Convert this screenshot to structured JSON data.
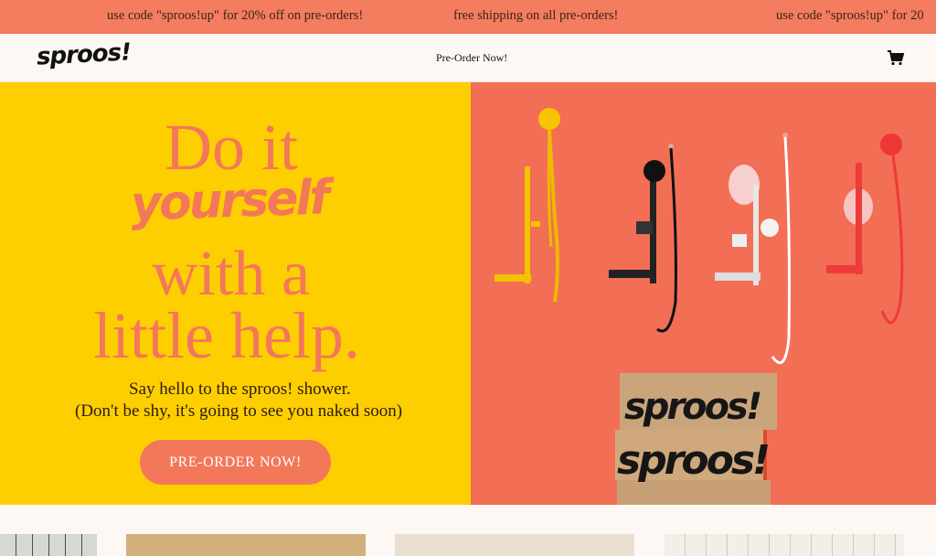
{
  "announcement": {
    "messages": [
      "use code \"sproos!up\" for 20% off on pre-orders!",
      "free shipping on all pre-orders!",
      "use code \"sproos!up\" for 20"
    ]
  },
  "header": {
    "logo": "sproos!",
    "nav_link": "Pre-Order Now!",
    "cart_icon": "cart-icon"
  },
  "hero": {
    "line1": "Do it",
    "line2": "yourself",
    "line3": "with a",
    "line4": "little help.",
    "sub1": "Say hello to the sproos! shower.",
    "sub2": "(Don't be shy, it's going to see you naked soon)",
    "cta": "PRE-ORDER NOW!",
    "box_label": "sproos!",
    "colors": {
      "left_bg": "#fecf00",
      "right_bg": "#f26e55",
      "accent": "#f3785a"
    }
  }
}
